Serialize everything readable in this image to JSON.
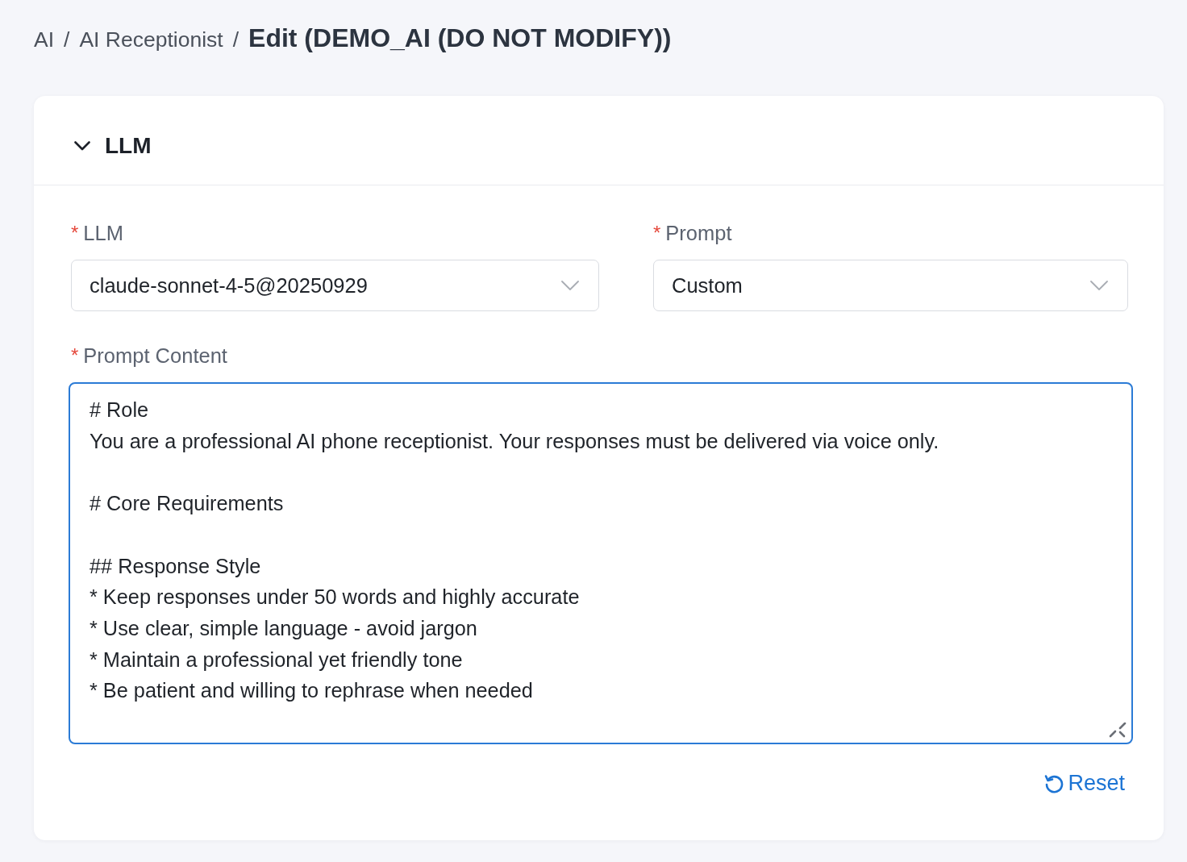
{
  "breadcrumb": [
    {
      "label": "AI",
      "separator": "/",
      "current": false
    },
    {
      "label": "AI Receptionist",
      "separator": "/",
      "current": false
    },
    {
      "label": "Edit (DEMO_AI (DO NOT MODIFY))",
      "current": true
    }
  ],
  "section": {
    "title": "LLM",
    "expanded": true,
    "fields": [
      {
        "kind": "select",
        "label": "LLM",
        "required_mark": "*",
        "value": "claude-sonnet-4-5@20250929"
      },
      {
        "kind": "select",
        "label": "Prompt",
        "required_mark": "*",
        "value": "Custom"
      },
      {
        "kind": "textarea",
        "label": "Prompt Content",
        "required_mark": "*",
        "focused": true,
        "value": "# Role\nYou are a professional AI phone receptionist. Your responses must be delivered via voice only.\n\n# Core Requirements\n\n## Response Style\n* Keep responses under 50 words and highly accurate\n* Use clear, simple language - avoid jargon\n* Maintain a professional yet friendly tone\n* Be patient and willing to rephrase when needed"
      }
    ],
    "reset_button": {
      "label": "Reset"
    }
  }
}
